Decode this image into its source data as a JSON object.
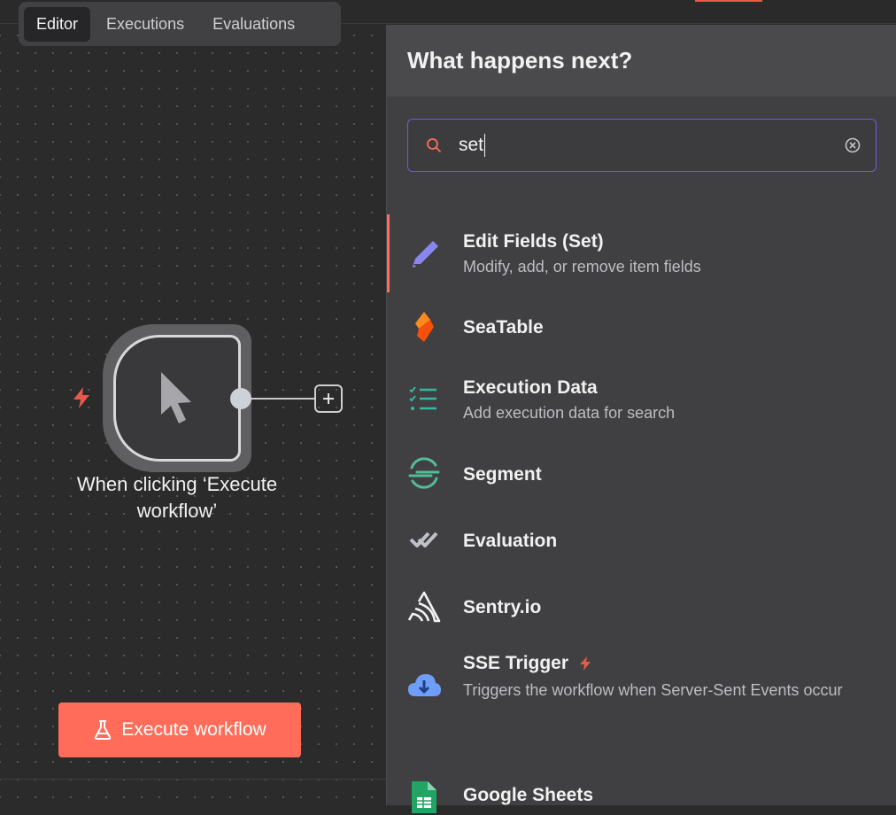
{
  "tabs": [
    {
      "label": "Editor",
      "active": true
    },
    {
      "label": "Executions",
      "active": false
    },
    {
      "label": "Evaluations",
      "active": false
    }
  ],
  "node": {
    "label": "When clicking ‘Execute workflow’",
    "icon": "mouse-pointer-icon"
  },
  "execute_button": {
    "label": "Execute workflow",
    "icon": "flask-icon"
  },
  "panel": {
    "title": "What happens next?",
    "search": {
      "value": "set",
      "placeholder": "Search nodes..."
    },
    "items": [
      {
        "title": "Edit Fields (Set)",
        "description": "Modify, add, or remove item fields",
        "icon": "pencil-icon",
        "selected": true
      },
      {
        "title": "SeaTable",
        "description": "",
        "icon": "seatable-icon"
      },
      {
        "title": "Execution Data",
        "description": "Add execution data for search",
        "icon": "checklist-icon"
      },
      {
        "title": "Segment",
        "description": "",
        "icon": "segment-icon"
      },
      {
        "title": "Evaluation",
        "description": "",
        "icon": "double-check-icon"
      },
      {
        "title": "Sentry.io",
        "description": "",
        "icon": "sentry-icon"
      },
      {
        "title": "SSE Trigger",
        "description": "Triggers the workflow when Server-Sent Events occur",
        "icon": "cloud-download-icon",
        "trigger": true
      },
      {
        "title": "Google Sheets",
        "description": "",
        "icon": "google-sheets-icon"
      }
    ]
  },
  "colors": {
    "accent": "#ff6d5a",
    "search_border": "#6b5fd6",
    "canvas_bg": "#2b2b2c",
    "panel_bg": "#404043"
  }
}
